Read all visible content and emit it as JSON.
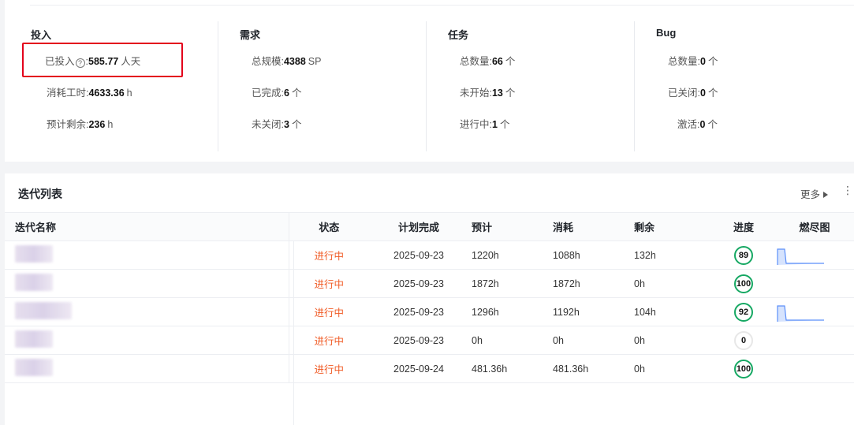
{
  "overview": {
    "invest": {
      "title": "投入",
      "items": [
        {
          "label": "已投入",
          "help": "?",
          "colon": ":",
          "value": "585.77",
          "unit": "人天"
        },
        {
          "label": "消耗工时:",
          "value": "4633.36",
          "unit": "h"
        },
        {
          "label": "预计剩余:",
          "value": "236",
          "unit": "h"
        }
      ]
    },
    "demand": {
      "title": "需求",
      "items": [
        {
          "label": "总规模:",
          "value": "4388",
          "unit": "SP"
        },
        {
          "label": "已完成:",
          "value": "6",
          "unit": "个"
        },
        {
          "label": "未关闭:",
          "value": "3",
          "unit": "个"
        }
      ]
    },
    "task": {
      "title": "任务",
      "items": [
        {
          "label": "总数量:",
          "value": "66",
          "unit": "个"
        },
        {
          "label": "未开始:",
          "value": "13",
          "unit": "个"
        },
        {
          "label": "进行中:",
          "value": "1",
          "unit": "个"
        }
      ]
    },
    "bug": {
      "title": "Bug",
      "items": [
        {
          "label": "总数量:",
          "value": "0",
          "unit": "个"
        },
        {
          "label": "已关闭:",
          "value": "0",
          "unit": "个"
        },
        {
          "label": "激活:",
          "value": "0",
          "unit": "个"
        }
      ]
    }
  },
  "iterations": {
    "title": "迭代列表",
    "more_label": "更多",
    "more_icon": "caret-right-icon",
    "menu_icon": "more-vertical-icon",
    "columns": [
      "迭代名称",
      "状态",
      "计划完成",
      "预计",
      "消耗",
      "剩余",
      "进度",
      "燃尽图"
    ],
    "rows": [
      {
        "status": "进行中",
        "plan_date": "2025-09-23",
        "estimate": "1220h",
        "consumed": "1088h",
        "remaining": "132h",
        "progress": "89",
        "burndown": true
      },
      {
        "status": "进行中",
        "plan_date": "2025-09-23",
        "estimate": "1872h",
        "consumed": "1872h",
        "remaining": "0h",
        "progress": "100",
        "burndown": false
      },
      {
        "status": "进行中",
        "plan_date": "2025-09-23",
        "estimate": "1296h",
        "consumed": "1192h",
        "remaining": "104h",
        "progress": "92",
        "burndown": true
      },
      {
        "status": "进行中",
        "plan_date": "2025-09-23",
        "estimate": "0h",
        "consumed": "0h",
        "remaining": "0h",
        "progress": "0",
        "burndown": false
      },
      {
        "status": "进行中",
        "plan_date": "2025-09-24",
        "estimate": "481.36h",
        "consumed": "481.36h",
        "remaining": "0h",
        "progress": "100",
        "burndown": false
      }
    ]
  },
  "colors": {
    "status": "#f05a24",
    "progress_ring": "#16a863",
    "highlight": "#e3001b",
    "spark_line": "#5b8ff9"
  }
}
